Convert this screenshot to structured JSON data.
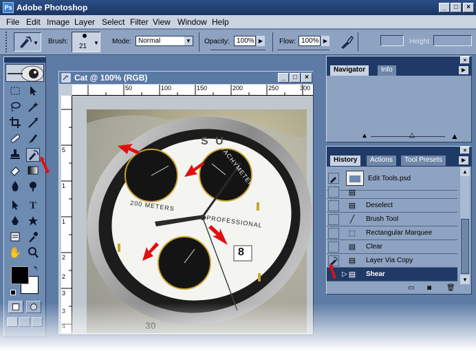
{
  "app": {
    "title": "Adobe Photoshop",
    "window_controls": {
      "minimize": "_",
      "maximize": "□",
      "close": "×"
    }
  },
  "menu": {
    "items": [
      "File",
      "Edit",
      "Image",
      "Layer",
      "Select",
      "Filter",
      "View",
      "Window",
      "Help"
    ]
  },
  "options": {
    "brush_label": "Brush:",
    "brush_size": "21",
    "mode_label": "Mode:",
    "mode_value": "Normal",
    "opacity_label": "Opacity:",
    "opacity_value": "100%",
    "flow_label": "Flow:",
    "flow_value": "100%",
    "height_label": "Height:"
  },
  "document": {
    "title": "Cat @ 100% (RGB)",
    "ruler_top": [
      "50",
      "100",
      "150",
      "200",
      "250",
      "300"
    ],
    "ruler_left": [
      "5",
      "1",
      "1",
      "2",
      "2",
      "3",
      "3",
      "4"
    ],
    "image_text": {
      "brand": "S U",
      "tachymeter": "TACHYMETER",
      "meters": "200 METERS",
      "professional": "PROFESSIONAL",
      "date": "8",
      "bezel": "30"
    }
  },
  "navigator": {
    "tabs": [
      "Navigator",
      "Info"
    ]
  },
  "history": {
    "tabs": [
      "History",
      "Actions",
      "Tool Presets"
    ],
    "snapshot": "Edit Tools.psd",
    "states": [
      "Deselect",
      "Brush Tool",
      "Rectangular Marquee",
      "Clear",
      "Layer Via Copy",
      "Shear"
    ]
  },
  "colors": {
    "accent": "#1f3a66",
    "arrow": "#e01010",
    "panel": "#8ea3c2"
  }
}
